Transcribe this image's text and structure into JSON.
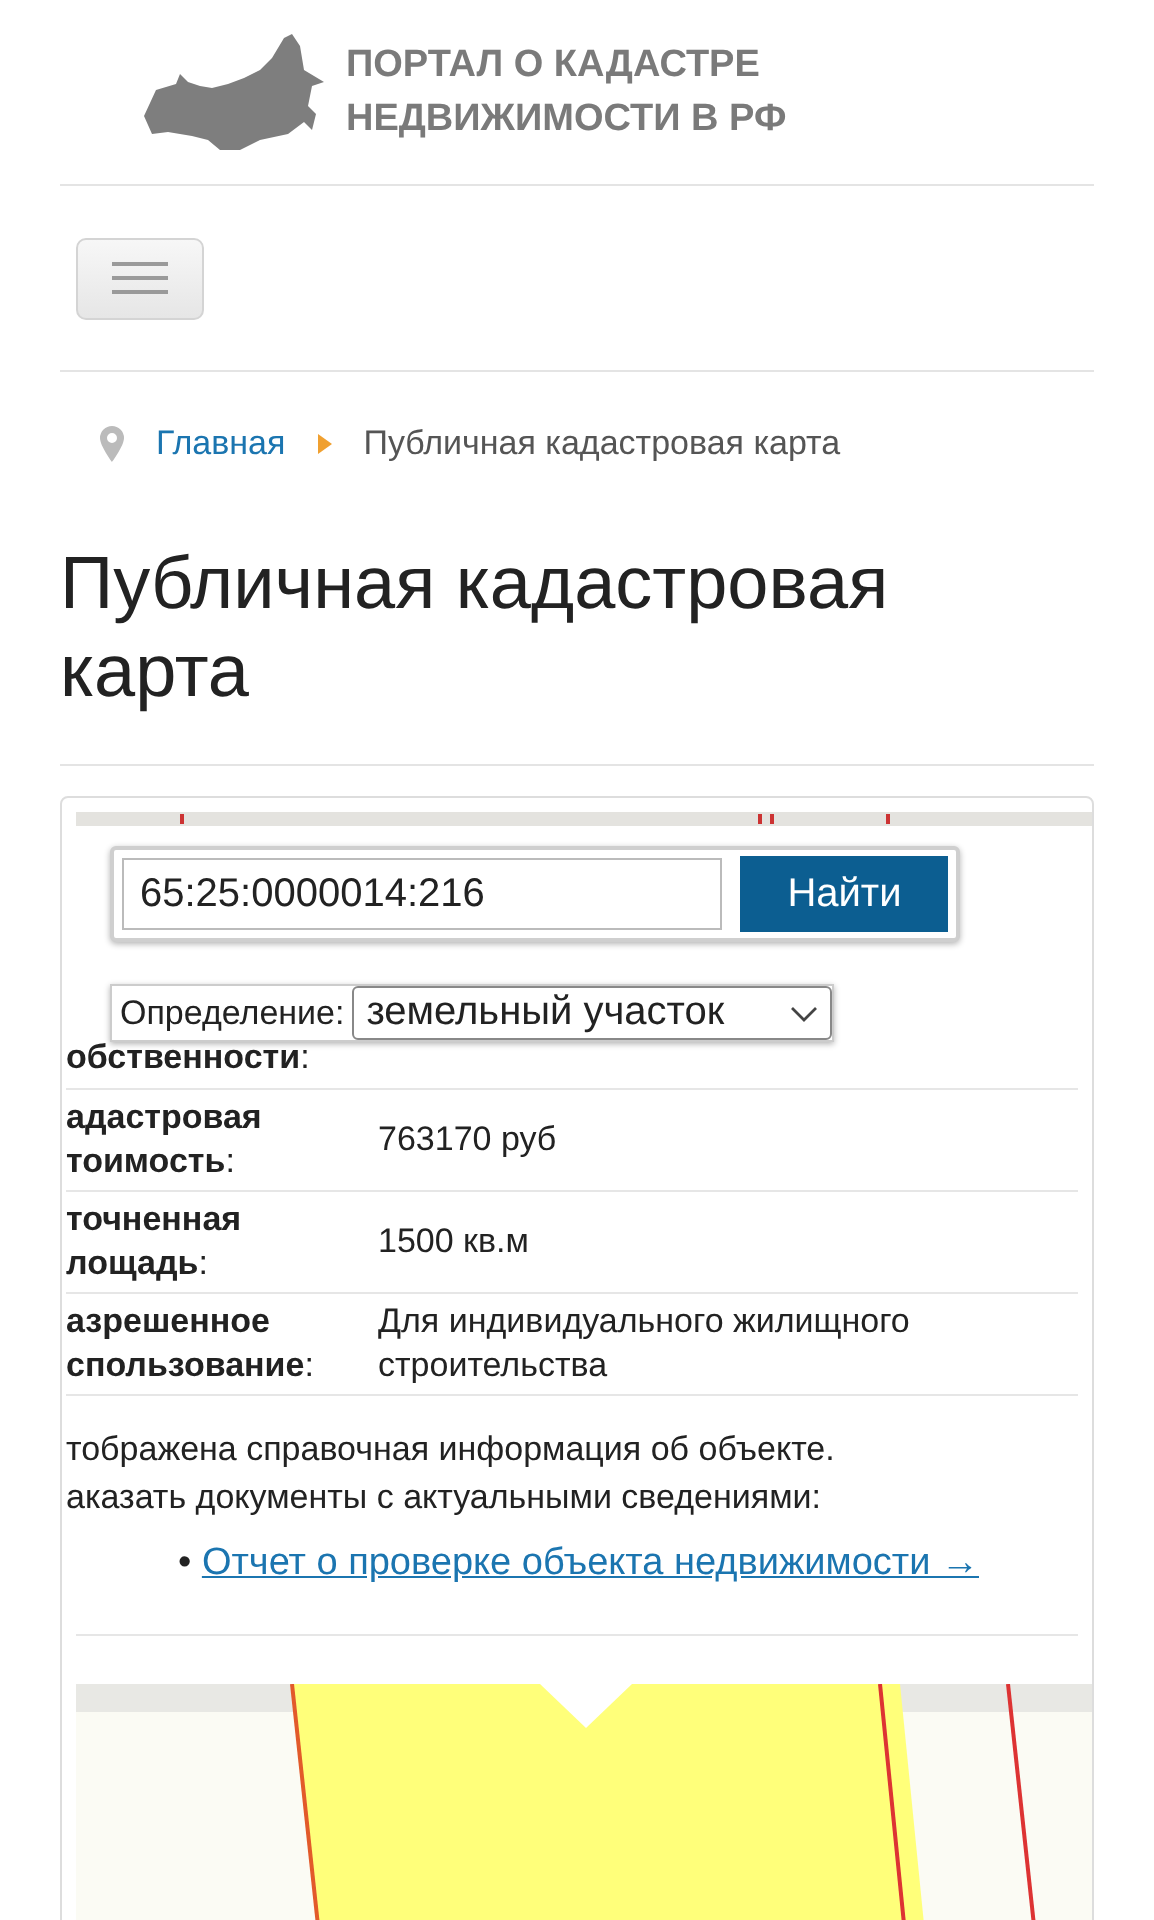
{
  "header": {
    "title_lines": [
      "ПОРТАЛ О КАДАСТРЕ",
      "НЕДВИЖИМОСТИ В РФ"
    ]
  },
  "breadcrumb": [
    {
      "label": "Главная",
      "kind": "link"
    },
    {
      "label": "Публичная кадастровая карта",
      "kind": "current"
    }
  ],
  "page_title": "Публичная кадастровая карта",
  "search": {
    "value": "65:25:0000014:216",
    "button": "Найти"
  },
  "definition": {
    "label": "Определение:",
    "value": "земельный участок"
  },
  "rows": [
    {
      "label": "**обственности**:"
    },
    {
      "label": "**адастровая тоимость**:",
      "value": "763170 руб"
    },
    {
      "label": "**точненная лощадь**:",
      "value": "1500 кв.м"
    },
    {
      "label": "**азрешенное спользование**:",
      "value": "Для индивидуального жилищного строительства"
    }
  ],
  "note": "тображена справочная информация об объекте. аказать документы с актуальными сведениями:",
  "links": [
    {
      "bullet": "•",
      "label": "Отчет о проверке объекта недвижимости →"
    }
  ]
}
